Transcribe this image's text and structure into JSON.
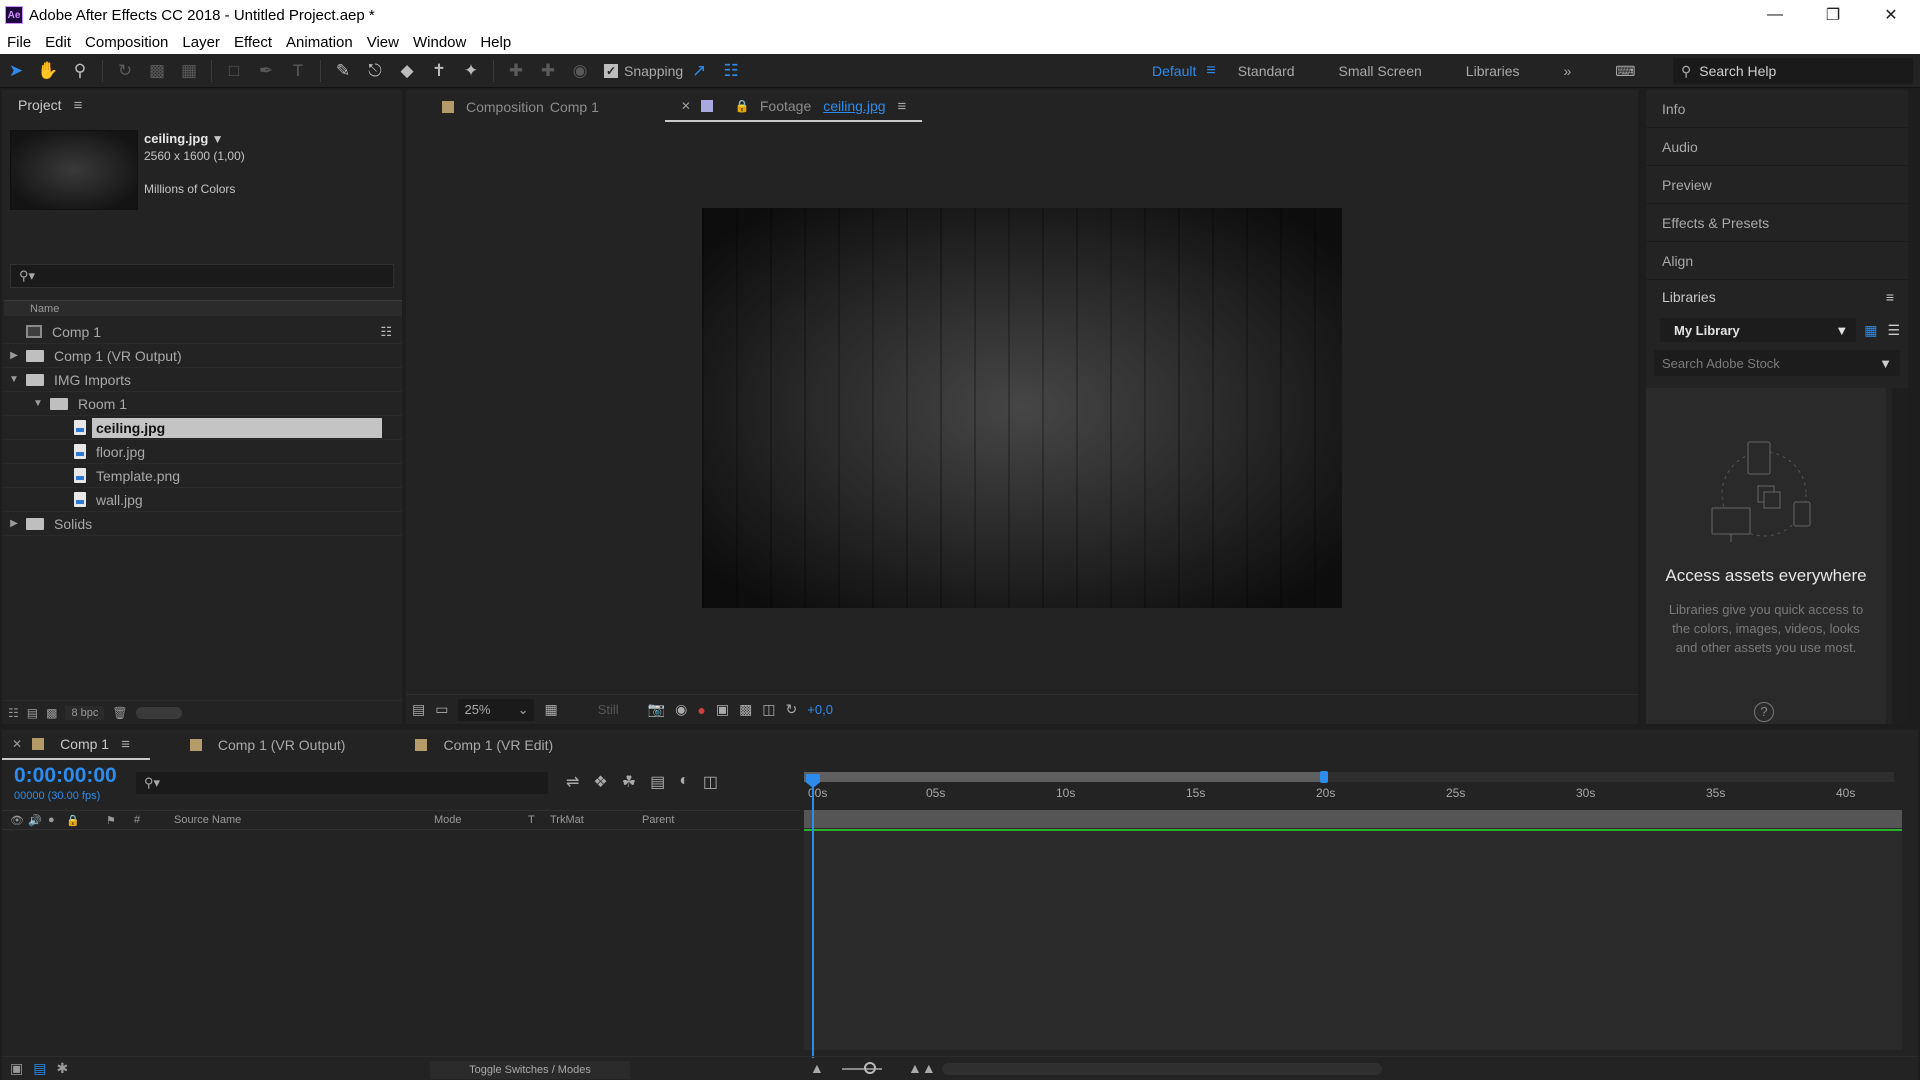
{
  "window": {
    "app_icon": "Ae",
    "title": "Adobe After Effects CC 2018 - Untitled Project.aep *",
    "controls": [
      "minimize-icon",
      "maximize-icon",
      "close-icon"
    ]
  },
  "menu": [
    "File",
    "Edit",
    "Composition",
    "Layer",
    "Effect",
    "Animation",
    "View",
    "Window",
    "Help"
  ],
  "toolbar": {
    "snapping_label": "Snapping",
    "workspaces": [
      "Default",
      "Standard",
      "Small Screen",
      "Libraries"
    ],
    "active_workspace": "Default",
    "search_help": "Search Help"
  },
  "project": {
    "title": "Project",
    "file": {
      "name": "ceiling.jpg",
      "dimensions": "2560 x 1600 (1,00)",
      "colors": "Millions of Colors"
    },
    "search_placeholder": "",
    "column_name": "Name",
    "items": [
      {
        "label": "Comp 1",
        "type": "comp",
        "indent": 0,
        "twirl": ""
      },
      {
        "label": "Comp 1 (VR Output)",
        "type": "folder",
        "indent": 0,
        "twirl": "▶"
      },
      {
        "label": "IMG Imports",
        "type": "folder",
        "indent": 0,
        "twirl": "▼"
      },
      {
        "label": "Room 1",
        "type": "folder",
        "indent": 1,
        "twirl": "▼"
      },
      {
        "label": "ceiling.jpg",
        "type": "file",
        "indent": 2,
        "twirl": "",
        "selected": true
      },
      {
        "label": "floor.jpg",
        "type": "file",
        "indent": 2,
        "twirl": ""
      },
      {
        "label": "Template.png",
        "type": "file",
        "indent": 2,
        "twirl": ""
      },
      {
        "label": "wall.jpg",
        "type": "file",
        "indent": 2,
        "twirl": ""
      },
      {
        "label": "Solids",
        "type": "folder",
        "indent": 0,
        "twirl": "▶"
      }
    ],
    "bpc": "8 bpc"
  },
  "viewer": {
    "tab_comp_prefix": "Composition",
    "tab_comp_name": "Comp 1",
    "tab_footage_prefix": "Footage",
    "tab_footage_name": "ceiling.jpg",
    "zoom": "25%",
    "still_label": "Still",
    "exposure": "+0,0"
  },
  "right_panel": {
    "items": [
      "Info",
      "Audio",
      "Preview",
      "Effects & Presets",
      "Align"
    ],
    "libraries_title": "Libraries",
    "library_select": "My Library",
    "stock_placeholder": "Search Adobe Stock",
    "access_title": "Access assets everywhere",
    "access_text": "Libraries give you quick access to the colors, images, videos, looks and other assets you use most.",
    "help": "?"
  },
  "timeline": {
    "tabs": [
      "Comp 1",
      "Comp 1 (VR Output)",
      "Comp 1 (VR Edit)"
    ],
    "active_tab": "Comp 1",
    "timecode": "0:00:00:00",
    "fps": "00000 (30.00 fps)",
    "columns": {
      "hash": "#",
      "source_name": "Source Name",
      "mode": "Mode",
      "t": "T",
      "trkmat": "TrkMat",
      "parent": "Parent"
    },
    "ruler_labels": [
      "00s",
      "05s",
      "10s",
      "15s",
      "20s",
      "25s",
      "30s",
      "35s",
      "40s"
    ],
    "work_area_end_s": 20,
    "toggle_label": "Toggle Switches / Modes"
  },
  "colors": {
    "accent": "#2d8ceb",
    "comp_swatch": "#b59a6a",
    "footage_swatch": "#a9a9e0",
    "layer_bar_line": "#29b129"
  }
}
